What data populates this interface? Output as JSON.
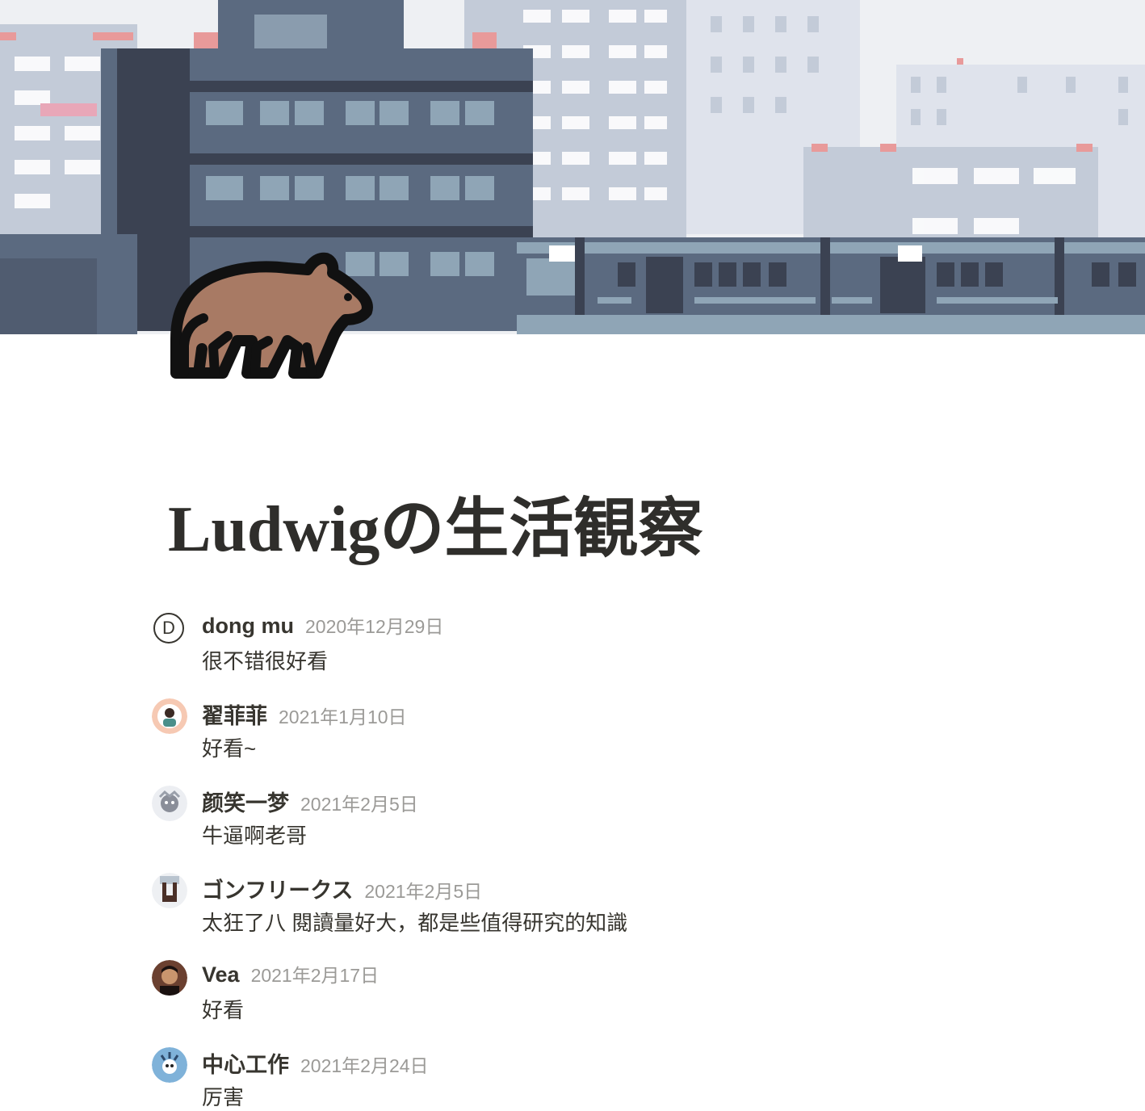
{
  "page": {
    "title": "Ludwigの生活観察",
    "icon": "bear-icon",
    "cover": "pixel-city-train-illustration"
  },
  "comments": [
    {
      "author": "dong mu",
      "date": "2020年12月29日",
      "text": "很不错很好看",
      "avatar": "D"
    },
    {
      "author": "翟菲菲",
      "date": "2021年1月10日",
      "text": "好看~",
      "avatar": "profile-photo"
    },
    {
      "author": "颜笑一梦",
      "date": "2021年2月5日",
      "text": "牛逼啊老哥",
      "avatar": "profile-photo"
    },
    {
      "author": "ゴンフリークス",
      "date": "2021年2月5日",
      "text": "太狂了八 閱讀量好大，都是些值得研究的知識",
      "avatar": "profile-photo"
    },
    {
      "author": "Vea",
      "date": "2021年2月17日",
      "text": "好看",
      "avatar": "profile-photo"
    },
    {
      "author": "中心工作",
      "date": "2021年2月24日",
      "text": "厉害",
      "avatar": "profile-photo"
    }
  ],
  "colors": {
    "text": "#37352f",
    "muted": "#9b9a97",
    "bear_fur": "#a87a64",
    "building_dark": "#5b6a80",
    "sky": "#eef0f3"
  }
}
